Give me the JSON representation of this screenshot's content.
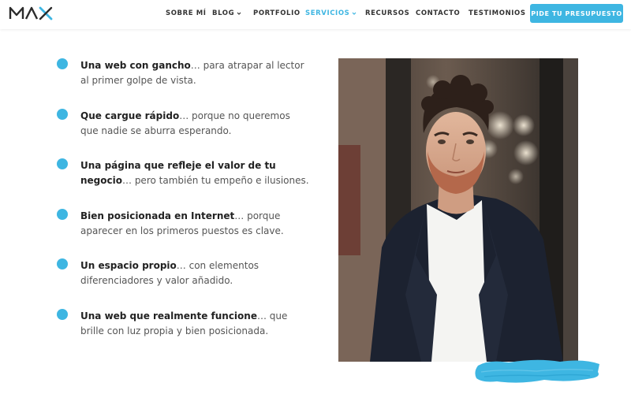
{
  "header": {
    "logo_text": "MAX",
    "nav": [
      {
        "label": "SOBRE MÍ",
        "has_dropdown": false,
        "active": false
      },
      {
        "label": "BLOG",
        "has_dropdown": true,
        "active": false
      },
      {
        "label": "PORTFOLIO",
        "has_dropdown": false,
        "active": false
      },
      {
        "label": "SERVICIOS",
        "has_dropdown": true,
        "active": true
      },
      {
        "label": "RECURSOS",
        "has_dropdown": false,
        "active": false
      },
      {
        "label": "CONTACTO",
        "has_dropdown": false,
        "active": false
      },
      {
        "label": "TESTIMONIOS",
        "has_dropdown": false,
        "active": false
      }
    ],
    "cta_label": "PIDE TU PRESUPUESTO"
  },
  "features": [
    {
      "bold": "Una web con gancho",
      "rest": "… para atrapar al lector al primer golpe de vista."
    },
    {
      "bold": "Que cargue rápido",
      "rest": "… porque no queremos que nadie se aburra esperando."
    },
    {
      "bold": "Una página que refleje el valor de tu negocio",
      "rest": "… pero también tu empeño e ilusiones."
    },
    {
      "bold": "Bien posicionada en Internet",
      "rest": "… porque aparecer en los primeros puestos es clave."
    },
    {
      "bold": "Un espacio propio",
      "rest": "… con elementos diferenciadores y valor añadido."
    },
    {
      "bold": "Una web que realmente funcione",
      "rest": "… que brille con luz propia y bien posicionada."
    }
  ],
  "colors": {
    "accent": "#3eb6e2",
    "text_bold": "#222222",
    "text": "#555555",
    "nav_text": "#333333"
  },
  "icons": [
    "chevron-down-icon",
    "bullet-dot-icon",
    "brush-stroke"
  ]
}
